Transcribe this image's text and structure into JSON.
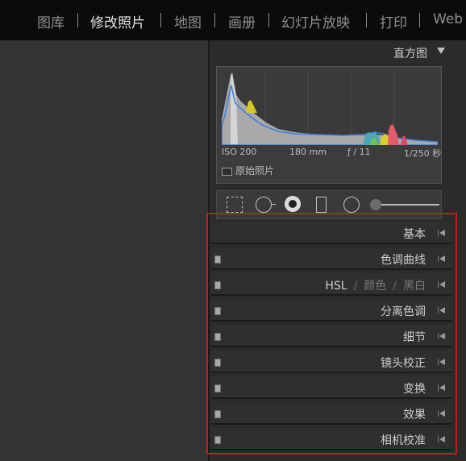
{
  "modules": [
    {
      "label": "图库",
      "active": false
    },
    {
      "label": "修改照片",
      "active": true
    },
    {
      "label": "地图",
      "active": false
    },
    {
      "label": "画册",
      "active": false
    },
    {
      "label": "幻灯片放映",
      "active": false
    },
    {
      "label": "打印",
      "active": false
    },
    {
      "label": "Web",
      "active": false
    }
  ],
  "histogram": {
    "title": "直方图",
    "iso": "ISO 200",
    "focal": "180 mm",
    "aperture": "ƒ / 11",
    "shutter": "1/250 秒",
    "original_label": "原始照片"
  },
  "tools": [
    "crop-overlay",
    "spot-removal",
    "red-eye-correction",
    "graduated-filter",
    "radial-filter",
    "adjustment-brush"
  ],
  "panels": [
    {
      "label": "基本",
      "has_switch": false
    },
    {
      "label": "色调曲线",
      "has_switch": true
    },
    {
      "label_main": "HSL",
      "label_alt1": "颜色",
      "label_alt2": "黑白",
      "has_switch": true,
      "composite": true
    },
    {
      "label": "分离色调",
      "has_switch": true
    },
    {
      "label": "细节",
      "has_switch": true
    },
    {
      "label": "镜头校正",
      "has_switch": true
    },
    {
      "label": "变换",
      "has_switch": true
    },
    {
      "label": "效果",
      "has_switch": true
    },
    {
      "label": "相机校准",
      "has_switch": true
    }
  ],
  "colors": {
    "highlight_outline": "#c11d1d",
    "topbar_bg": "#0b0b0b",
    "panel_bg": "#2b2b2b"
  }
}
